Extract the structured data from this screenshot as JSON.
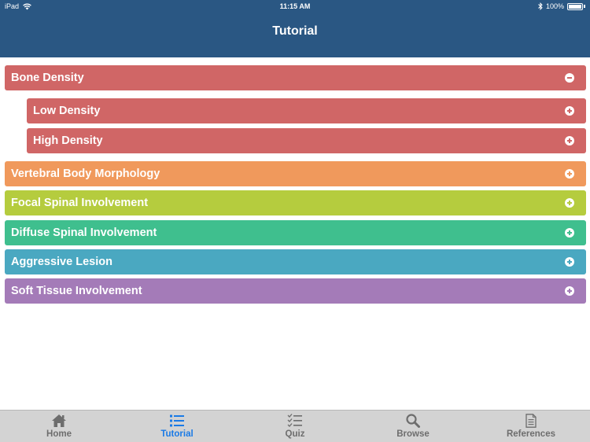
{
  "status": {
    "carrier": "iPad",
    "time": "11:15 AM",
    "battery": "100%"
  },
  "nav": {
    "title": "Tutorial"
  },
  "sections": [
    {
      "label": "Bone Density",
      "color": "#d06666",
      "expanded": true,
      "level": 0
    },
    {
      "label": "Low Density",
      "color": "#d06666",
      "expanded": false,
      "level": 1
    },
    {
      "label": "High Density",
      "color": "#d06666",
      "expanded": false,
      "level": 1
    },
    {
      "label": "Vertebral Body Morphology",
      "color": "#f0995c",
      "expanded": false,
      "level": 0
    },
    {
      "label": "Focal Spinal Involvement",
      "color": "#b5cc3e",
      "expanded": false,
      "level": 0
    },
    {
      "label": "Diffuse Spinal Involvement",
      "color": "#3fbf8e",
      "expanded": false,
      "level": 0
    },
    {
      "label": "Aggressive Lesion",
      "color": "#4aa8c1",
      "expanded": false,
      "level": 0
    },
    {
      "label": "Soft Tissue Involvement",
      "color": "#a47bb8",
      "expanded": false,
      "level": 0
    }
  ],
  "tabs": [
    {
      "label": "Home",
      "icon": "home-icon",
      "active": false
    },
    {
      "label": "Tutorial",
      "icon": "list-icon",
      "active": true
    },
    {
      "label": "Quiz",
      "icon": "checklist-icon",
      "active": false
    },
    {
      "label": "Browse",
      "icon": "search-icon",
      "active": false
    },
    {
      "label": "References",
      "icon": "document-icon",
      "active": false
    }
  ],
  "colors": {
    "nav_bar": "#2a5783",
    "tab_active": "#1a7ae6",
    "tab_inactive": "#6d6d6d",
    "tab_bar": "#d3d3d3"
  }
}
